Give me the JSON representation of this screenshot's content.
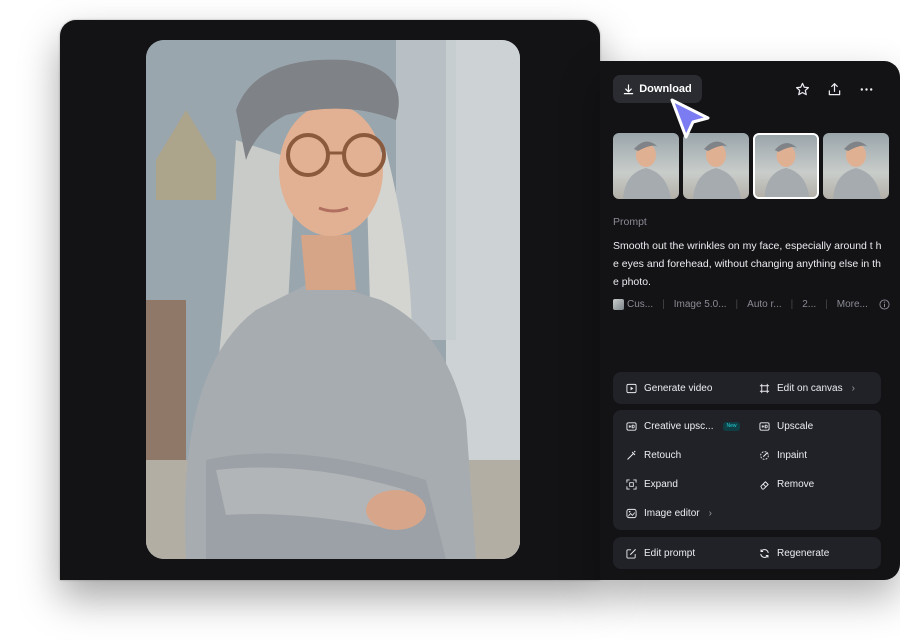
{
  "toolbar": {
    "download_label": "Download",
    "icons": [
      "star-icon",
      "share-upload-icon",
      "more-options-icon"
    ]
  },
  "thumbnails": {
    "count_label": "",
    "items": [
      {
        "name": "thumbnail-1",
        "selected": false
      },
      {
        "name": "thumbnail-2",
        "selected": false
      },
      {
        "name": "thumbnail-3",
        "selected": true
      },
      {
        "name": "thumbnail-4",
        "selected": false
      }
    ]
  },
  "prompt": {
    "label": "Prompt",
    "text": "Smooth out the wrinkles on my face, especially around t he eyes and forehead, without changing anything else in the photo."
  },
  "meta": {
    "style": "Cus...",
    "model": "Image 5.0...",
    "ratio": "Auto r...",
    "count": "2...",
    "more": "More..."
  },
  "actions": {
    "generate_video": "Generate video",
    "edit_on_canvas": "Edit on canvas",
    "creative_upscale": "Creative upsc...",
    "new_badge": "New",
    "upscale": "Upscale",
    "retouch": "Retouch",
    "inpaint": "Inpaint",
    "expand": "Expand",
    "remove": "Remove",
    "image_editor": "Image editor",
    "edit_prompt": "Edit prompt",
    "regenerate": "Regenerate"
  },
  "colors": {
    "panel_bg": "#131316",
    "button_bg": "#2b2c31",
    "group_bg": "#212227",
    "cursor": "#7b7cf2",
    "new_badge": "#25d0d4"
  }
}
